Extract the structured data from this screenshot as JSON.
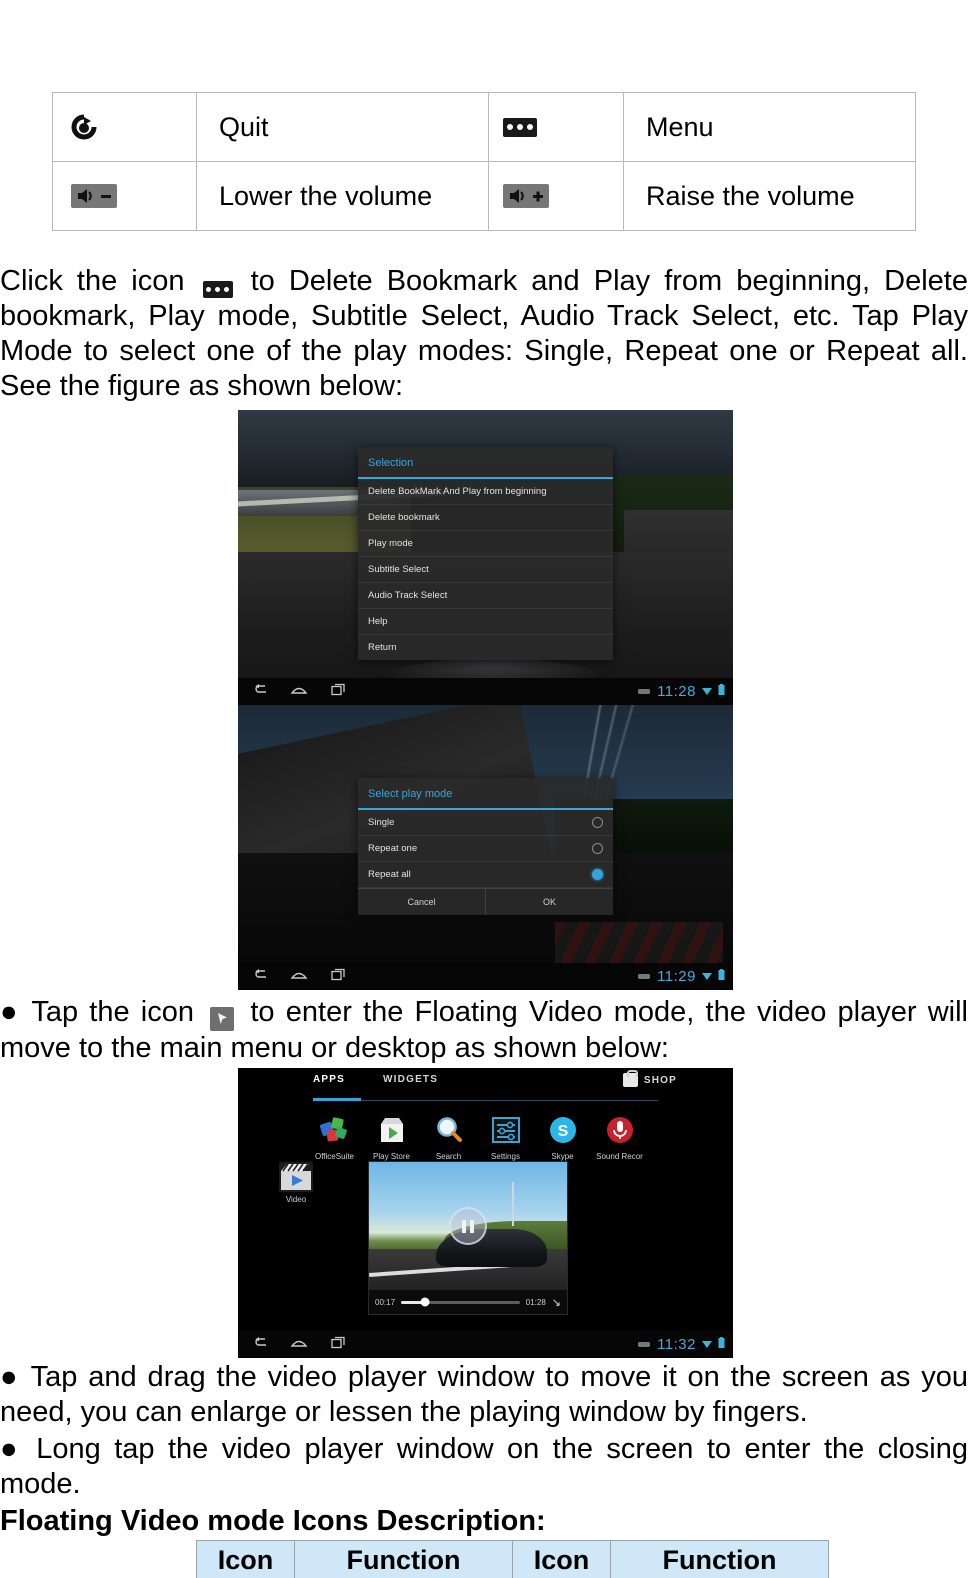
{
  "top_table": {
    "rows": [
      {
        "icon_left": "refresh-circle-icon",
        "fn_left": "Quit",
        "icon_right": "menu-dots-icon",
        "fn_right": "Menu"
      },
      {
        "icon_left": "volume-down-icon",
        "fn_left": "Lower the volume",
        "icon_right": "volume-up-icon",
        "fn_right": "Raise the volume"
      }
    ]
  },
  "paragraphs": {
    "p1_a": "Click the icon",
    "p1_b": "to Delete Bookmark and Play from beginning, Delete bookmark, Play mode, Subtitle Select, Audio Track Select, etc. Tap Play Mode to select one of the play modes: Single, Repeat one or Repeat all. See the figure as shown below:",
    "p2_a": "● Tap the icon",
    "p2_b": "to enter the Floating Video mode, the video player will move to the main menu or desktop as shown below:",
    "p3": "● Tap and drag the video player window to move it on the screen as you need, you can enlarge or lessen the playing window by fingers.",
    "p4": "● Long tap the video player window on the screen to enter the closing mode.",
    "p5": "Floating Video mode Icons Description:"
  },
  "screenshot1": {
    "dialog_title": "Selection",
    "items": [
      "Delete BookMark And Play from beginning",
      "Delete bookmark",
      "Play mode",
      "Subtitle Select",
      "Audio Track Select",
      "Help",
      "Return"
    ],
    "clock": "11:28",
    "nav": [
      "back-icon",
      "home-icon",
      "recents-icon"
    ],
    "status_icons": [
      "usb-icon",
      "wifi-icon",
      "battery-icon"
    ]
  },
  "screenshot2": {
    "dialog_title": "Select play mode",
    "options": [
      {
        "label": "Single",
        "selected": false
      },
      {
        "label": "Repeat one",
        "selected": false
      },
      {
        "label": "Repeat all",
        "selected": true
      }
    ],
    "buttons": {
      "cancel": "Cancel",
      "ok": "OK"
    },
    "clock": "11:29",
    "nav": [
      "back-icon",
      "home-icon",
      "recents-icon"
    ],
    "status_icons": [
      "usb-icon",
      "wifi-icon",
      "battery-icon"
    ]
  },
  "screenshot3": {
    "tabs": [
      "APPS",
      "WIDGETS"
    ],
    "active_tab": "APPS",
    "shop_label": "SHOP",
    "apps": [
      {
        "label": "OfficeSuite",
        "icon": "officesuite-icon"
      },
      {
        "label": "Play Store",
        "icon": "play-store-icon"
      },
      {
        "label": "Search",
        "icon": "search-icon"
      },
      {
        "label": "Settings",
        "icon": "settings-icon"
      },
      {
        "label": "Skype",
        "icon": "skype-icon"
      },
      {
        "label": "Sound Recor",
        "icon": "sound-recorder-icon"
      }
    ],
    "video_app": {
      "label": "Video",
      "icon": "video-app-icon"
    },
    "player": {
      "elapsed": "00:17",
      "duration": "01:28",
      "state": "paused",
      "resize_icon": "resize-handle-icon"
    },
    "clock": "11:32",
    "nav": [
      "back-icon",
      "home-icon",
      "recents-icon"
    ],
    "status_icons": [
      "usb-icon",
      "wifi-icon",
      "battery-icon"
    ]
  },
  "bottom_table": {
    "headers": [
      "Icon",
      "Function",
      "Icon",
      "Function"
    ],
    "header_bg": "#cfe7f7"
  },
  "colors": {
    "accent_blue": "#37a8db",
    "table_header_blue": "#cfe7f7",
    "border_gray": "#b9b9b9"
  }
}
